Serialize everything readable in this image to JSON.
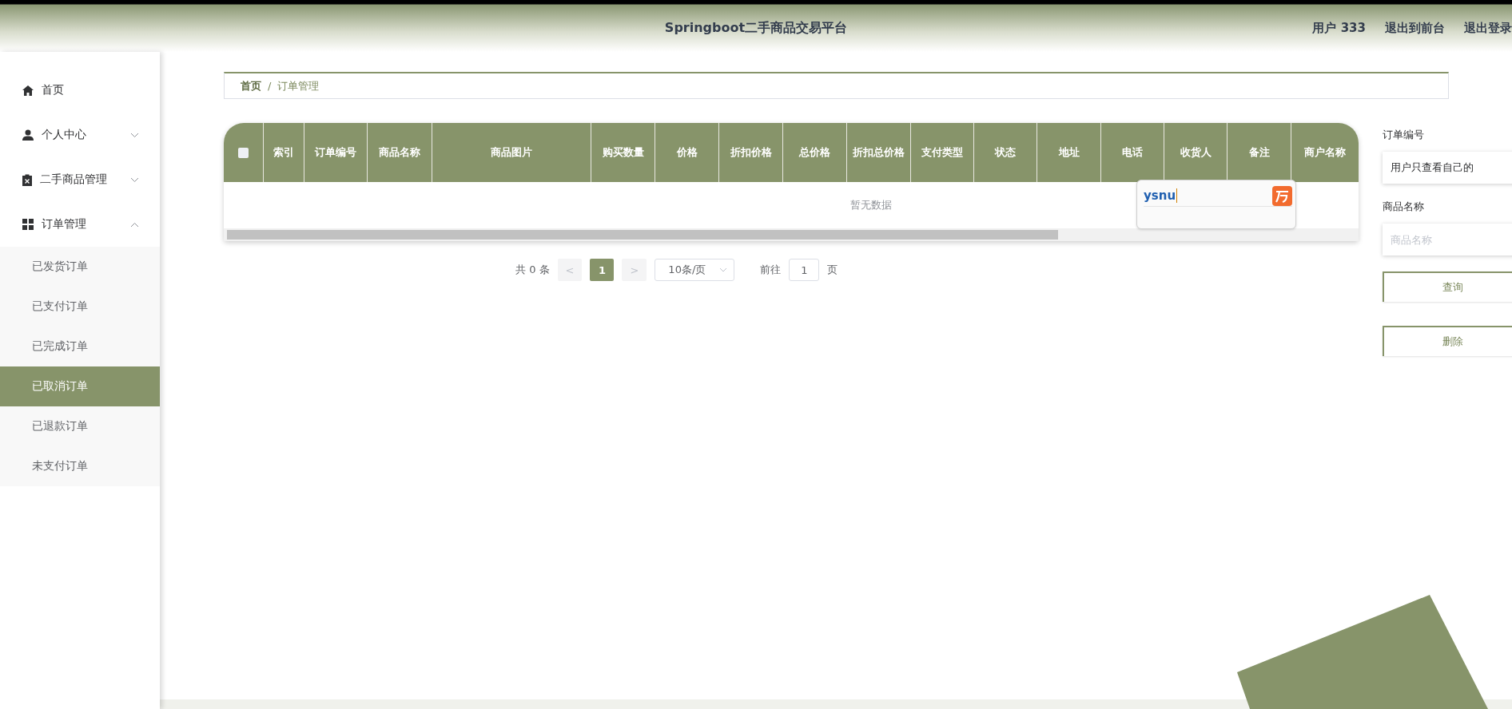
{
  "header": {
    "title": "Springboot二手商品交易平台",
    "links": [
      {
        "label": "用户 333"
      },
      {
        "label": "退出到前台"
      },
      {
        "label": "退出登录"
      }
    ]
  },
  "sidebar": {
    "items": [
      {
        "kind": "link",
        "label": "首页"
      },
      {
        "kind": "menu",
        "label": "个人中心",
        "expanded": false
      },
      {
        "kind": "menu",
        "label": "二手商品管理",
        "expanded": false
      },
      {
        "kind": "menu",
        "label": "订单管理",
        "expanded": true,
        "children": [
          {
            "label": "已发货订单",
            "selected": false
          },
          {
            "label": "已支付订单",
            "selected": false
          },
          {
            "label": "已完成订单",
            "selected": false
          },
          {
            "label": "已取消订单",
            "selected": true
          },
          {
            "label": "已退款订单",
            "selected": false
          },
          {
            "label": "未支付订单",
            "selected": false
          }
        ]
      }
    ]
  },
  "breadcrumb": [
    "首页",
    "/",
    "订单管理"
  ],
  "table": {
    "select_all": {
      "checked": false
    },
    "columns": [
      "索引",
      "订单编号",
      "商品名称",
      "商品图片",
      "购买数量",
      "价格",
      "折扣价格",
      "总价格",
      "折扣总价格",
      "支付类型",
      "状态",
      "地址",
      "电话",
      "收货人",
      "备注",
      "商户名称"
    ],
    "empty_text": "暂无数据"
  },
  "ime_popup": {
    "composition": "ysnu"
  },
  "pagination": {
    "total": "共 0 条",
    "prev": "<",
    "pages": [
      {
        "label": "1",
        "selected": true
      }
    ],
    "next": ">",
    "page_size": "10条/页",
    "goto_label": "前往",
    "goto_value": "1",
    "goto_suffix": "页"
  },
  "search": {
    "fields": [
      {
        "label": "订单编号",
        "value": "用户只查看自己的"
      },
      {
        "label": "商品名称",
        "placeholder": "商品名称"
      }
    ],
    "buttons": [
      "查询",
      "删除"
    ]
  }
}
